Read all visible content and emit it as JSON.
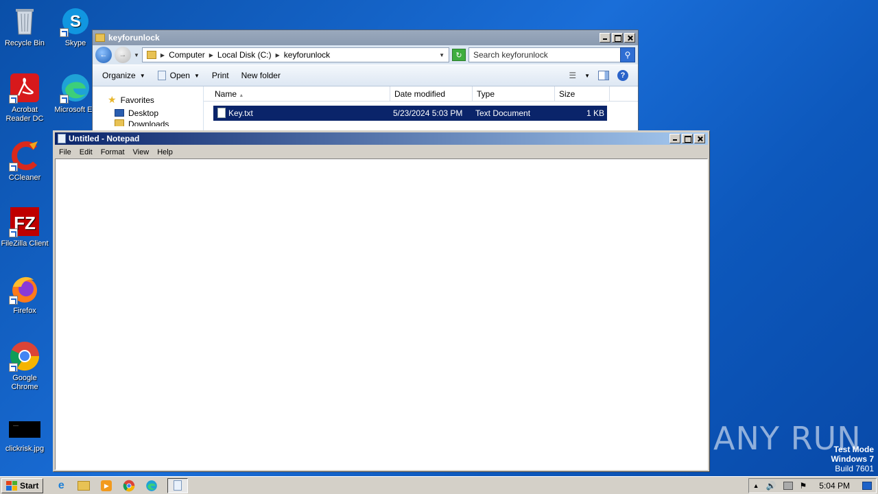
{
  "desktop": {
    "icons": [
      {
        "label": "Recycle Bin",
        "icon": "recycle-bin-icon"
      },
      {
        "label": "Skype",
        "icon": "skype-icon"
      },
      {
        "label": "Acrobat Reader DC",
        "icon": "acrobat-icon"
      },
      {
        "label": "Microsoft Ed",
        "icon": "edge-icon"
      },
      {
        "label": "CCleaner",
        "icon": "ccleaner-icon"
      },
      {
        "label": "FileZilla Client",
        "icon": "filezilla-icon"
      },
      {
        "label": "Firefox",
        "icon": "firefox-icon"
      },
      {
        "label": "Google Chrome",
        "icon": "chrome-icon"
      },
      {
        "label": "clickrisk.jpg",
        "icon": "image-file-icon"
      }
    ]
  },
  "explorer": {
    "title": "keyforunlock",
    "breadcrumbs": [
      "Computer",
      "Local Disk (C:)",
      "keyforunlock"
    ],
    "search_placeholder": "Search keyforunlock",
    "toolbar": {
      "organize": "Organize",
      "open": "Open",
      "print": "Print",
      "new_folder": "New folder"
    },
    "nav": {
      "favorites": "Favorites",
      "desktop": "Desktop",
      "downloads": "Downloads"
    },
    "columns": [
      "Name",
      "Date modified",
      "Type",
      "Size"
    ],
    "files": [
      {
        "name": "Key.txt",
        "date": "5/23/2024 5:03 PM",
        "type": "Text Document",
        "size": "1 KB"
      }
    ]
  },
  "notepad": {
    "title": "Untitled - Notepad",
    "menu": [
      "File",
      "Edit",
      "Format",
      "View",
      "Help"
    ],
    "content": ""
  },
  "taskbar": {
    "start": "Start",
    "clock": "5:04 PM"
  },
  "watermark": {
    "line1": "Test Mode",
    "line2": "Windows 7",
    "line3": "Build 7601",
    "brand": "ANY RUN"
  }
}
